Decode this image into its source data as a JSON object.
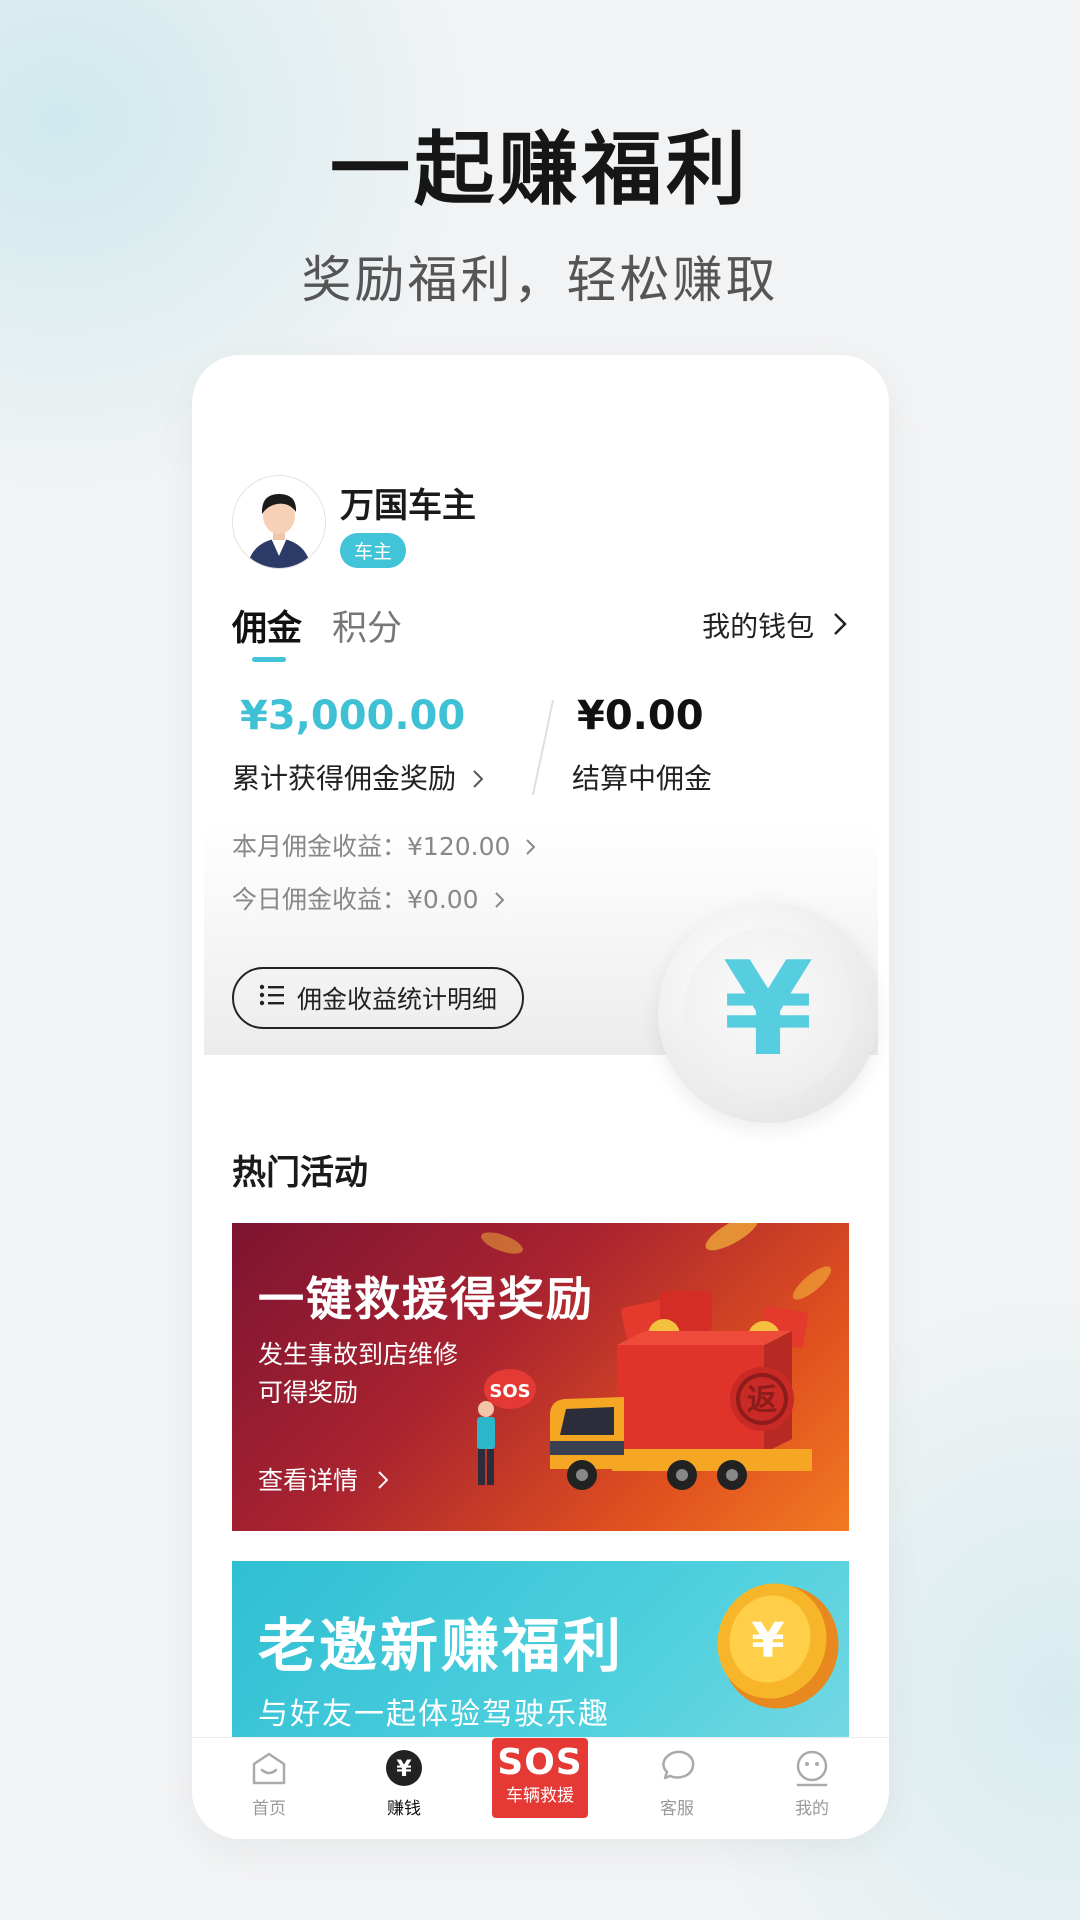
{
  "hero": {
    "title": "一起赚福利",
    "subtitle": "奖励福利，轻松赚取"
  },
  "profile": {
    "name": "万国车主",
    "role_badge": "车主"
  },
  "tabs": [
    {
      "label": "佣金",
      "active": true
    },
    {
      "label": "积分",
      "active": false
    }
  ],
  "wallet_link": "我的钱包",
  "stats": {
    "cumulative_amount": "¥3,000.00",
    "cumulative_label": "累计获得佣金奖励",
    "settling_amount": "¥0.00",
    "settling_label": "结算中佣金",
    "month_label": "本月佣金收益：",
    "month_value": "¥120.00",
    "today_label": "今日佣金收益：",
    "today_value": "¥0.00"
  },
  "detail_button": "佣金收益统计明细",
  "coin_glyph": "¥",
  "section_title": "热门活动",
  "banners": [
    {
      "title": "一键救援得奖励",
      "sub1": "发生事故到店维修",
      "sub2": "可得奖励",
      "link": "查看详情",
      "sos_bubble": "SOS",
      "box_text": "返"
    },
    {
      "title": "老邀新赚福利",
      "sub": "与好友一起体验驾驶乐趣"
    }
  ],
  "bottom_nav": [
    {
      "label": "首页",
      "icon": "home-icon",
      "active": false
    },
    {
      "label": "赚钱",
      "icon": "earn-icon",
      "active": true
    },
    {
      "label": "车辆救援",
      "icon": "sos-icon",
      "sos_text": "SOS"
    },
    {
      "label": "客服",
      "icon": "chat-icon",
      "active": false
    },
    {
      "label": "我的",
      "icon": "profile-icon",
      "active": false
    }
  ],
  "colors": {
    "accent": "#41c4d7",
    "sos": "#e53935",
    "rescue_banner_start": "#7d1431",
    "rescue_banner_end": "#f27a22",
    "invite_banner": "#2fbfd3"
  }
}
